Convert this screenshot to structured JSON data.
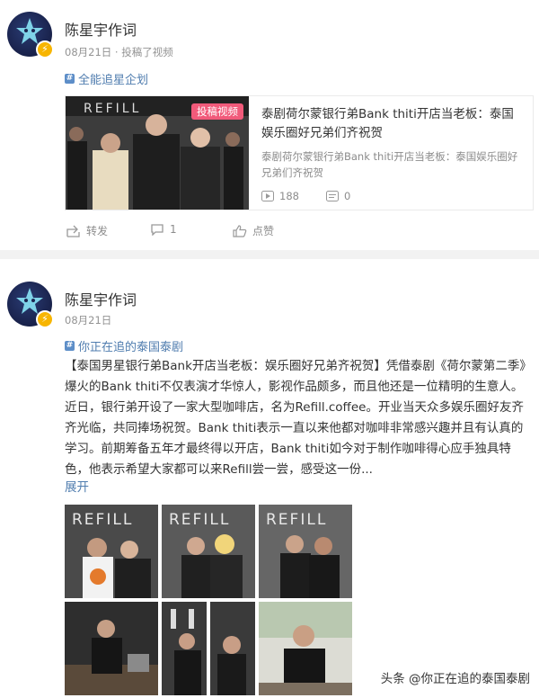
{
  "post1": {
    "author": "陈星宇作词",
    "meta": "08月21日 · 投稿了视频",
    "topic": "全能追星企划",
    "card": {
      "tag": "投稿视频",
      "title": "泰剧荷尔蒙银行弟Bank thiti开店当老板：泰国娱乐圈好兄弟们齐祝贺",
      "desc": "泰剧荷尔蒙银行弟Bank thiti开店当老板：泰国娱乐圈好兄弟们齐祝贺",
      "plays": "188",
      "comments": "0",
      "image_sign": "REFILL"
    },
    "actions": {
      "repost": "转发",
      "comment": "1",
      "like": "点赞"
    }
  },
  "post2": {
    "author": "陈星宇作词",
    "meta": "08月21日",
    "topic": "你正在追的泰国泰剧",
    "text": "【泰国男星银行弟Bank开店当老板：娱乐圈好兄弟齐祝贺】凭借泰剧《荷尔蒙第二季》爆火的Bank thiti不仅表演才华惊人，影视作品颇多，而且他还是一位精明的生意人。近日，银行弟开设了一家大型咖啡店，名为Refill.coffee。开业当天众多娱乐圈好友齐齐光临，共同捧场祝贺。Bank thiti表示一直以来他都对咖啡非常感兴趣并且有认真的学习。前期筹备五年才最终得以开店，Bank thiti如今对于制作咖啡得心应手独具特色，他表示希望大家都可以来Refill尝一尝，感受这一份...",
    "expand": "展开",
    "photo_signs": [
      "REFILL",
      "REFILL",
      "REFILL"
    ]
  },
  "watermark": "头条 @你正在追的泰国泰剧",
  "colors": {
    "link": "#507daf",
    "tag": "#f15a7a",
    "separator": "#f2f2f2"
  }
}
